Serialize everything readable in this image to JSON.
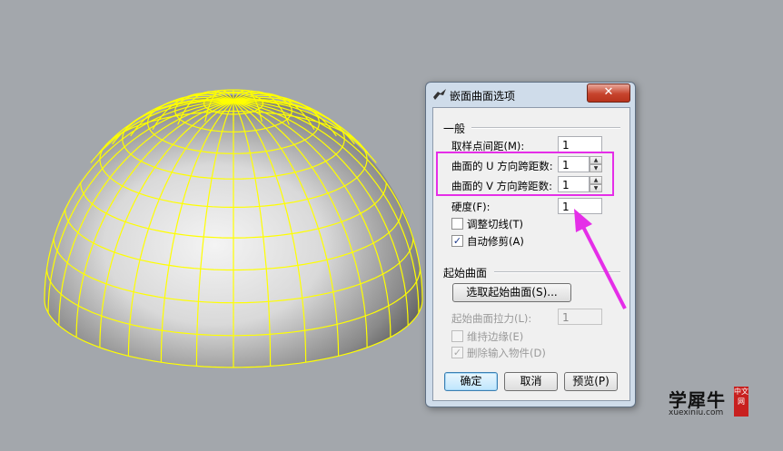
{
  "dialog": {
    "title": "嵌面曲面选项",
    "close_label": "✕",
    "general_group": "一般",
    "sample_spacing": {
      "label": "取样点间距(M):",
      "value": "1"
    },
    "u_spans": {
      "label": "曲面的 U 方向跨距数:",
      "value": "1"
    },
    "v_spans": {
      "label": "曲面的 V 方向跨距数:",
      "value": "1"
    },
    "stiffness": {
      "label": "硬度(F):",
      "value": "1"
    },
    "adjust_tangency": {
      "label": "调整切线(T)",
      "checked": false
    },
    "auto_trim": {
      "label": "自动修剪(A)",
      "checked": true
    },
    "starting_surface_group": "起始曲面",
    "select_starting_surface": "选取起始曲面(S)...",
    "starting_surface_pull": {
      "label": "起始曲面拉力(L):",
      "value": "1"
    },
    "preserve_edges": {
      "label": "维持边缘(E)",
      "checked": false
    },
    "delete_input": {
      "label": "删除输入物件(D)",
      "checked": true
    },
    "ok_label": "确定",
    "cancel_label": "取消",
    "preview_label": "预览(P)",
    "check_mark": "✓",
    "spin_up": "▲",
    "spin_down": "▼"
  },
  "annotation": {
    "highlight_color": "#e52ee8"
  },
  "watermark": {
    "brand": "学犀牛",
    "site": "xuexiniu.com",
    "badge": "中文网"
  },
  "colors": {
    "wireframe": "#ffff00",
    "viewport_bg": "#a3a7ac"
  }
}
